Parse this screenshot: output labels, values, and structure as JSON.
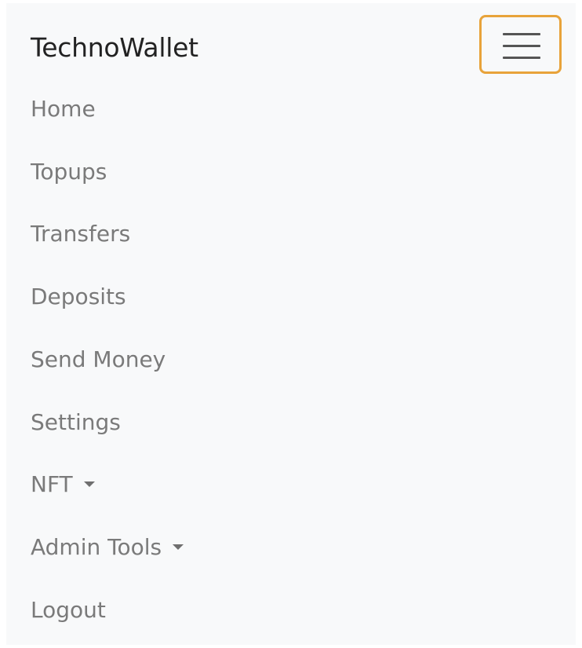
{
  "navbar": {
    "brand": "TechnoWallet",
    "toggler_icon": "hamburger-icon",
    "toggler_border_color": "#e8a33a",
    "background_color": "#f8f9fa",
    "items": [
      {
        "label": "Home"
      },
      {
        "label": "Topups"
      },
      {
        "label": "Transfers"
      },
      {
        "label": "Deposits"
      },
      {
        "label": "Send Money"
      },
      {
        "label": "Settings"
      },
      {
        "label": "NFT",
        "dropdown": true
      },
      {
        "label": "Admin Tools",
        "dropdown": true
      },
      {
        "label": "Logout"
      }
    ]
  }
}
